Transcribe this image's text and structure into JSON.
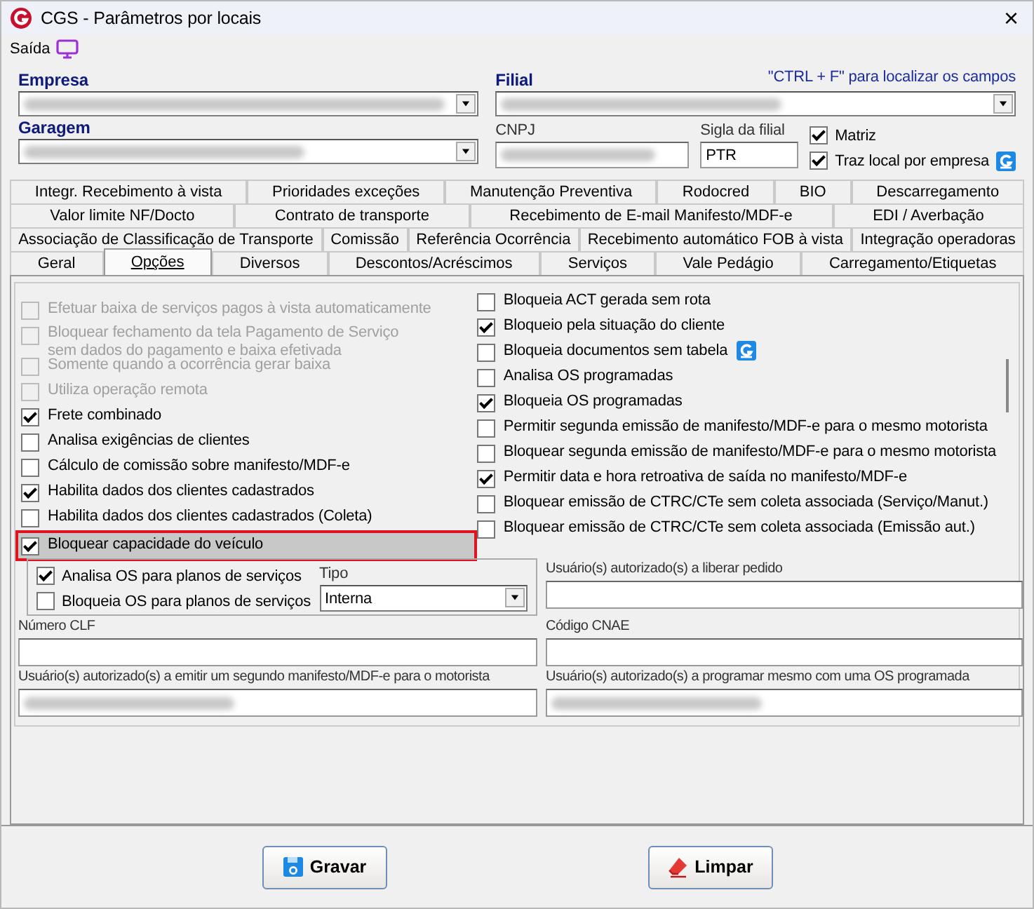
{
  "window": {
    "title": "CGS - Parâmetros por locais",
    "close": "×"
  },
  "menu": {
    "label": "Saída"
  },
  "header": {
    "empresa": {
      "label": "Empresa",
      "redacted": true
    },
    "filial": {
      "label": "Filial",
      "redacted": true
    },
    "hint": "\"CTRL + F\" para localizar os campos",
    "garagem": {
      "label": "Garagem",
      "redacted": true
    },
    "cnpj": {
      "label": "CNPJ",
      "redacted": true
    },
    "sigla": {
      "label": "Sigla da filial",
      "value": "PTR"
    },
    "checks": [
      {
        "label": "Matriz",
        "checked": true,
        "badge": false
      },
      {
        "label": "Traz local por empresa",
        "checked": true,
        "badge": true
      }
    ]
  },
  "tab_rows": [
    [
      {
        "label": "Integr. Recebimento à vista",
        "selected": false
      },
      {
        "label": "Prioridades exceções",
        "selected": false
      },
      {
        "label": "Manutenção Preventiva",
        "selected": false
      },
      {
        "label": "Rodocred",
        "selected": false
      },
      {
        "label": "BIO",
        "selected": false
      },
      {
        "label": "Descarregamento",
        "selected": false
      }
    ],
    [
      {
        "label": "Valor limite NF/Docto",
        "selected": false
      },
      {
        "label": "Contrato de transporte",
        "selected": false
      },
      {
        "label": "Recebimento de E-mail Manifesto/MDF-e",
        "selected": false
      },
      {
        "label": "EDI / Averbação",
        "selected": false
      }
    ],
    [
      {
        "label": "Associação de Classificação de Transporte",
        "selected": false
      },
      {
        "label": "Comissão",
        "selected": false
      },
      {
        "label": "Referência Ocorrência",
        "selected": false
      },
      {
        "label": "Recebimento automático FOB à vista",
        "selected": false
      },
      {
        "label": "Integração operadoras",
        "selected": false
      }
    ],
    [
      {
        "label": "Geral",
        "selected": false
      },
      {
        "label": "Opções",
        "selected": true
      },
      {
        "label": "Diversos",
        "selected": false
      },
      {
        "label": "Descontos/Acréscimos",
        "selected": false
      },
      {
        "label": "Serviços",
        "selected": false
      },
      {
        "label": "Vale Pedágio",
        "selected": false
      },
      {
        "label": "Carregamento/Etiquetas",
        "selected": false
      }
    ]
  ],
  "options_left": [
    {
      "label": "Efetuar baixa de serviços pagos à vista automaticamente",
      "checked": false,
      "disabled": true,
      "highlighted": false
    },
    {
      "label": "Bloquear fechamento da tela Pagamento de Serviço sem dados do pagamento e baixa efetivada",
      "checked": false,
      "disabled": true,
      "highlighted": false
    },
    {
      "label": "Somente quando a ocorrência gerar baixa",
      "checked": false,
      "disabled": true,
      "highlighted": false
    },
    {
      "label": "Utiliza operação remota",
      "checked": false,
      "disabled": true,
      "highlighted": false
    },
    {
      "label": "Frete combinado",
      "checked": true,
      "disabled": false,
      "highlighted": false
    },
    {
      "label": "Analisa exigências de clientes",
      "checked": false,
      "disabled": false,
      "highlighted": false
    },
    {
      "label": "Cálculo de comissão sobre manifesto/MDF-e",
      "checked": false,
      "disabled": false,
      "highlighted": false
    },
    {
      "label": "Habilita dados dos clientes cadastrados",
      "checked": true,
      "disabled": false,
      "highlighted": false
    },
    {
      "label": "Habilita dados dos clientes cadastrados (Coleta)",
      "checked": false,
      "disabled": false,
      "highlighted": false
    },
    {
      "label": "Bloquear capacidade do veículo",
      "checked": true,
      "disabled": false,
      "highlighted": true
    }
  ],
  "options_right": [
    {
      "label": "Bloqueia ACT gerada sem rota",
      "checked": false,
      "badge": false
    },
    {
      "label": "Bloqueio pela situação do cliente",
      "checked": true,
      "badge": false
    },
    {
      "label": "Bloqueia documentos sem tabela",
      "checked": false,
      "badge": true
    },
    {
      "label": "Analisa OS programadas",
      "checked": false,
      "badge": false
    },
    {
      "label": "Bloqueia OS programadas",
      "checked": true,
      "badge": false
    },
    {
      "label": "Permitir segunda emissão de manifesto/MDF-e para o mesmo motorista",
      "checked": false,
      "badge": false
    },
    {
      "label": "Bloquear segunda emissão de manifesto/MDF-e para o mesmo motorista",
      "checked": false,
      "badge": false
    },
    {
      "label": "Permitir data e hora retroativa de saída no manifesto/MDF-e",
      "checked": true,
      "badge": false
    },
    {
      "label": "Bloquear emissão de CTRC/CTe sem coleta associada (Serviço/Manut.)",
      "checked": false,
      "badge": false
    },
    {
      "label": "Bloquear emissão de CTRC/CTe sem coleta associada (Emissão aut.)",
      "checked": false,
      "badge": false
    }
  ],
  "os_group": {
    "checks": [
      {
        "label": "Analisa OS para planos de serviços",
        "checked": true
      },
      {
        "label": "Bloqueia OS para planos de serviços",
        "checked": false
      }
    ],
    "tipo": {
      "label": "Tipo",
      "value": "Interna"
    }
  },
  "text_fields": [
    {
      "label": "Usuário(s) autorizado(s) a liberar pedido",
      "redacted": false
    },
    {
      "label": "Número CLF",
      "redacted": false
    },
    {
      "label": "Código CNAE",
      "redacted": false
    },
    {
      "label": "Usuário(s) autorizado(s) a emitir um segundo manifesto/MDF-e para o motorista",
      "redacted": true
    },
    {
      "label": "Usuário(s) autorizado(s) a programar mesmo com uma OS programada",
      "redacted": true
    }
  ],
  "buttons": [
    {
      "label": "Gravar",
      "kind": "save"
    },
    {
      "label": "Limpar",
      "kind": "clear"
    }
  ]
}
